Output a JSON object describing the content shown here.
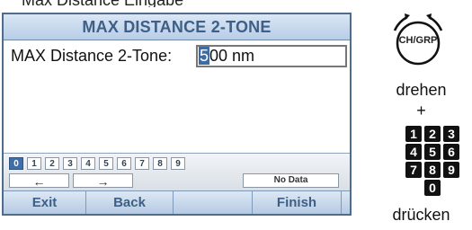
{
  "cropped_text": "Max Distance Eingabe",
  "screen": {
    "title": "MAX DISTANCE 2-TONE",
    "field_label": "MAX Distance 2-Tone:",
    "field_value_caret": "5",
    "field_value_rest": "00 nm"
  },
  "keypad": {
    "digits": [
      "0",
      "1",
      "2",
      "3",
      "4",
      "5",
      "6",
      "7",
      "8",
      "9"
    ],
    "left_arrow": "←",
    "right_arrow": "→",
    "no_data": "No Data"
  },
  "softkeys": {
    "exit": "Exit",
    "back": "Back",
    "finish": "Finish"
  },
  "instructions": {
    "knob_label": "CH/GRP",
    "rotate": "drehen",
    "plus": "+",
    "press": "drücken",
    "numbers": [
      "1",
      "2",
      "3",
      "4",
      "5",
      "6",
      "7",
      "8",
      "9",
      "0"
    ]
  },
  "colors": {
    "screen_border": "#4f6c8a",
    "title_text": "#3f5f85",
    "selected_digit": "#3f6ea8"
  }
}
